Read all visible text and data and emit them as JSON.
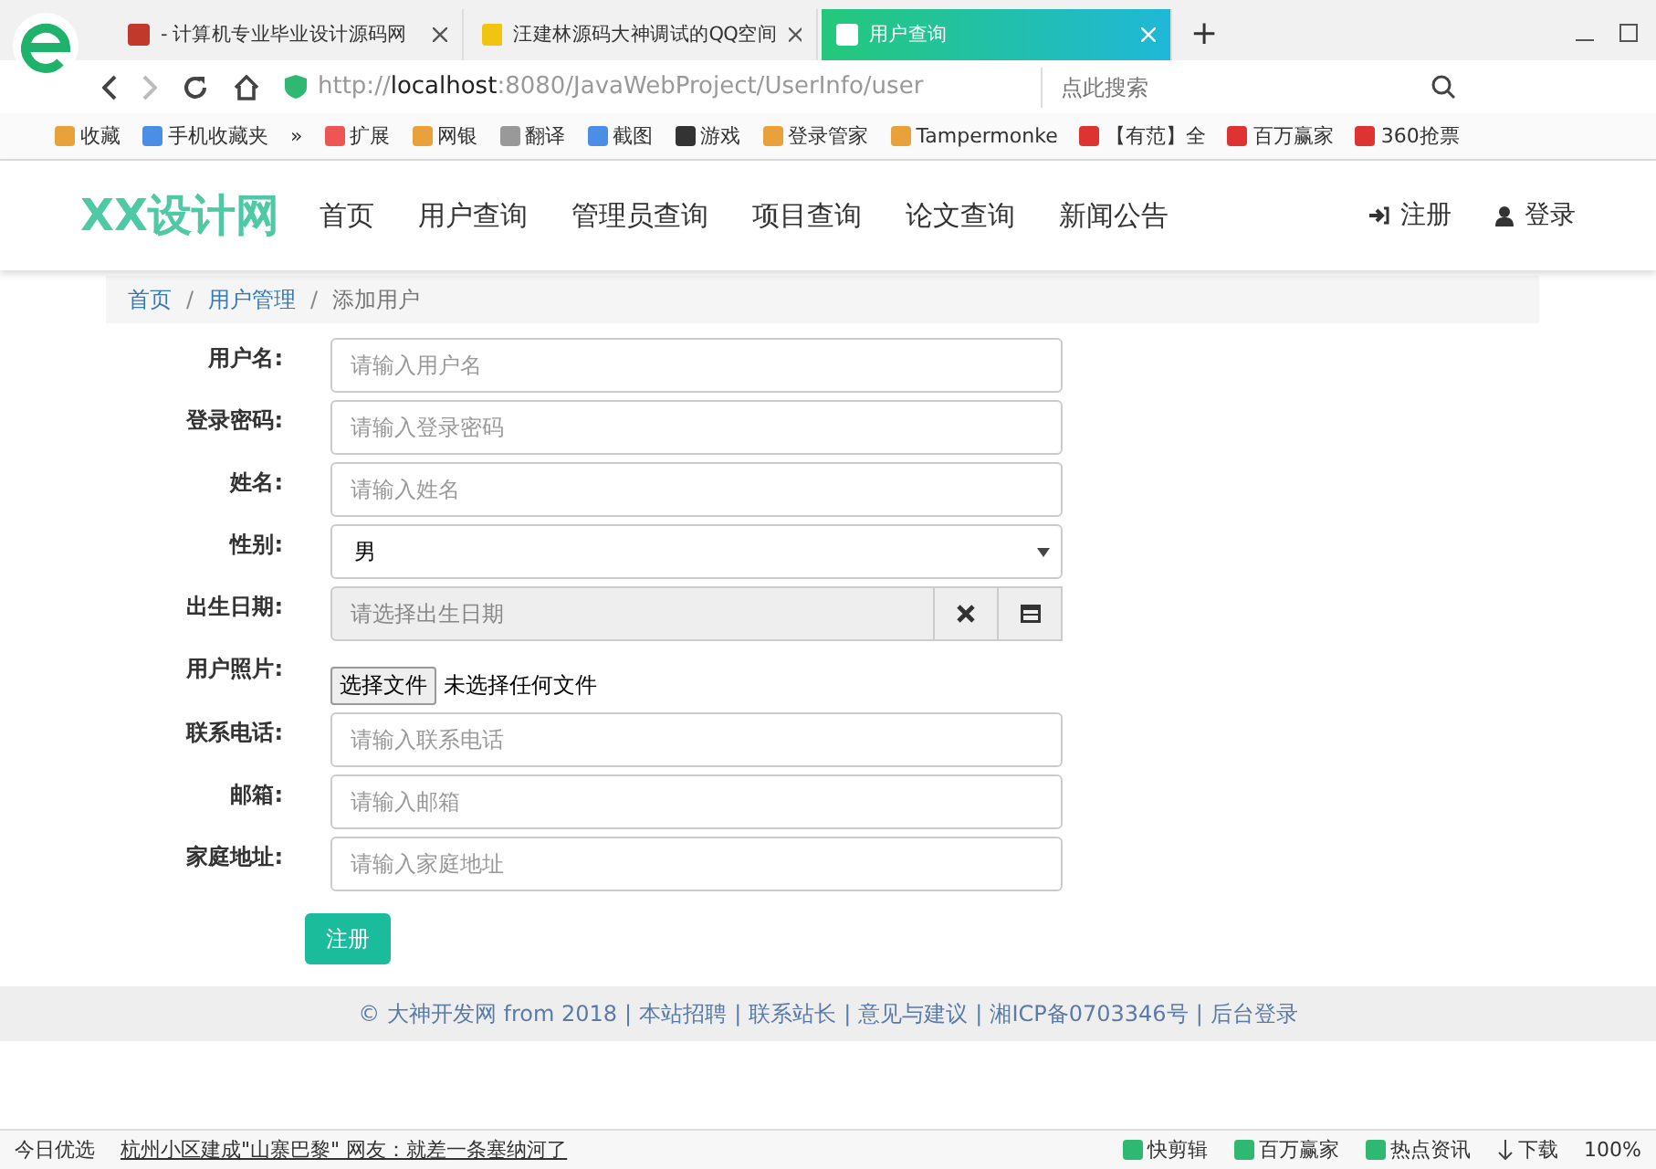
{
  "browser": {
    "tabs": [
      {
        "title": "- 计算机专业毕业设计源码网",
        "selected": false
      },
      {
        "title": "汪建林源码大神调试的QQ空间",
        "selected": false
      },
      {
        "title": "用户查询",
        "selected": true
      }
    ],
    "new_tab": "+",
    "address": "http://**localhost**:8080/JavaWebProject/UserInfo/user",
    "search_placeholder": "点此搜索",
    "bookmarks": [
      "收藏",
      "手机收藏夹",
      "»",
      "扩展",
      "网银",
      "翻译",
      "截图",
      "游戏",
      "登录管家",
      "Tampermonke",
      "【有范】全",
      "百万赢家",
      "360抢票"
    ]
  },
  "navbar": {
    "brand": "XX设计网",
    "items": [
      "首页",
      "用户查询",
      "管理员查询",
      "项目查询",
      "论文查询",
      "新闻公告"
    ],
    "right": [
      {
        "label": "注册",
        "kind": "signup"
      },
      {
        "label": "登录",
        "kind": "login"
      }
    ]
  },
  "breadcrumb": {
    "separator": "/",
    "items": [
      {
        "label": "首页",
        "active": false
      },
      {
        "label": "用户管理",
        "active": false
      },
      {
        "label": "添加用户",
        "active": true
      }
    ]
  },
  "form": {
    "fields": [
      {
        "label": "用户名:",
        "kind": "text",
        "placeholder": "请输入用户名"
      },
      {
        "label": "登录密码:",
        "kind": "text",
        "placeholder": "请输入登录密码"
      },
      {
        "label": "姓名:",
        "kind": "text",
        "placeholder": "请输入姓名"
      },
      {
        "label": "性别:",
        "kind": "select",
        "value": "男"
      },
      {
        "label": "出生日期:",
        "kind": "date",
        "placeholder": "请选择出生日期"
      },
      {
        "label": "用户照片:",
        "kind": "file",
        "button": "选择文件",
        "value": "未选择任何文件"
      },
      {
        "label": "联系电话:",
        "kind": "text",
        "placeholder": "请输入联系电话"
      },
      {
        "label": "邮箱:",
        "kind": "text",
        "placeholder": "请输入邮箱"
      },
      {
        "label": "家庭地址:",
        "kind": "text",
        "placeholder": "请输入家庭地址"
      }
    ],
    "submit": "注册"
  },
  "footer": {
    "copyright": "© 大神开发网 from 2018",
    "separator": "|",
    "links": [
      "本站招聘",
      "联系站长",
      "意见与建议",
      "湘ICP备0703346号",
      "后台登录"
    ]
  },
  "status_bar": {
    "left": "今日优选",
    "news": "杭州小区建成\"山寨巴黎\" 网友：就差一条塞纳河了",
    "items": [
      "快剪辑",
      "百万赢家",
      "热点资讯"
    ],
    "download": "下载",
    "zoom": "100%"
  }
}
